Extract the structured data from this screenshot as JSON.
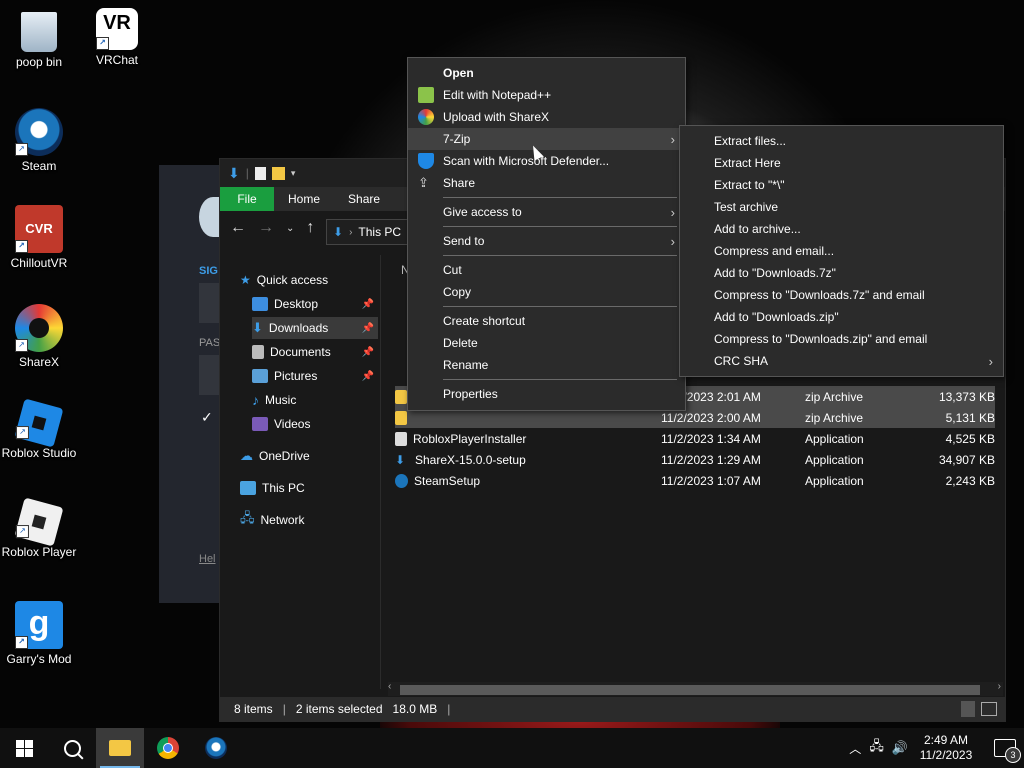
{
  "desktop": {
    "icons": [
      {
        "label": "poop bin"
      },
      {
        "label": "VRChat",
        "glyph": "VR"
      },
      {
        "label": "Steam"
      },
      {
        "label": "ChilloutVR",
        "glyph": "CVR"
      },
      {
        "label": "ShareX"
      },
      {
        "label": "Roblox Studio"
      },
      {
        "label": "Roblox Player"
      },
      {
        "label": "Garry's Mod",
        "glyph": "g"
      }
    ],
    "steam_login": {
      "sign_label": "SIG",
      "pass_label": "PAS",
      "help_label": "Hel"
    }
  },
  "explorer": {
    "ribbon_tabs": [
      "File",
      "Home",
      "Share"
    ],
    "address": "This PC",
    "column_header": "N",
    "sidebar": [
      {
        "label": "Quick access"
      },
      {
        "label": "Desktop"
      },
      {
        "label": "Downloads"
      },
      {
        "label": "Documents"
      },
      {
        "label": "Pictures"
      },
      {
        "label": "Music"
      },
      {
        "label": "Videos"
      },
      {
        "label": "OneDrive"
      },
      {
        "label": "This PC"
      },
      {
        "label": "Network"
      }
    ],
    "files": [
      {
        "name": "",
        "date": "11/2/2023 2:01 AM",
        "type": "zip Archive",
        "size": "13,373 KB",
        "selected": true
      },
      {
        "name": "",
        "date": "11/2/2023 2:00 AM",
        "type": "zip Archive",
        "size": "5,131 KB",
        "selected": true
      },
      {
        "name": "RobloxPlayerInstaller",
        "date": "11/2/2023 1:34 AM",
        "type": "Application",
        "size": "4,525 KB"
      },
      {
        "name": "ShareX-15.0.0-setup",
        "date": "11/2/2023 1:29 AM",
        "type": "Application",
        "size": "34,907 KB"
      },
      {
        "name": "SteamSetup",
        "date": "11/2/2023 1:07 AM",
        "type": "Application",
        "size": "2,243 KB"
      }
    ],
    "status": {
      "items": "8 items",
      "selected": "2 items selected",
      "size": "18.0 MB"
    }
  },
  "context_menu": {
    "items": [
      {
        "label": "Open"
      },
      {
        "label": "Edit with Notepad++"
      },
      {
        "label": "Upload with ShareX"
      },
      {
        "label": "7-Zip"
      },
      {
        "label": "Scan with Microsoft Defender..."
      },
      {
        "label": "Share"
      },
      {
        "label": "Give access to"
      },
      {
        "label": "Send to"
      },
      {
        "label": "Cut"
      },
      {
        "label": "Copy"
      },
      {
        "label": "Create shortcut"
      },
      {
        "label": "Delete"
      },
      {
        "label": "Rename"
      },
      {
        "label": "Properties"
      }
    ]
  },
  "zip_submenu": {
    "items": [
      {
        "label": "Extract files..."
      },
      {
        "label": "Extract Here"
      },
      {
        "label": "Extract to \"*\\\""
      },
      {
        "label": "Test archive"
      },
      {
        "label": "Add to archive..."
      },
      {
        "label": "Compress and email..."
      },
      {
        "label": "Add to \"Downloads.7z\""
      },
      {
        "label": "Compress to \"Downloads.7z\" and email"
      },
      {
        "label": "Add to \"Downloads.zip\""
      },
      {
        "label": "Compress to \"Downloads.zip\" and email"
      },
      {
        "label": "CRC SHA"
      }
    ]
  },
  "taskbar": {
    "time": "2:49 AM",
    "date": "11/2/2023",
    "notification_count": "3"
  }
}
